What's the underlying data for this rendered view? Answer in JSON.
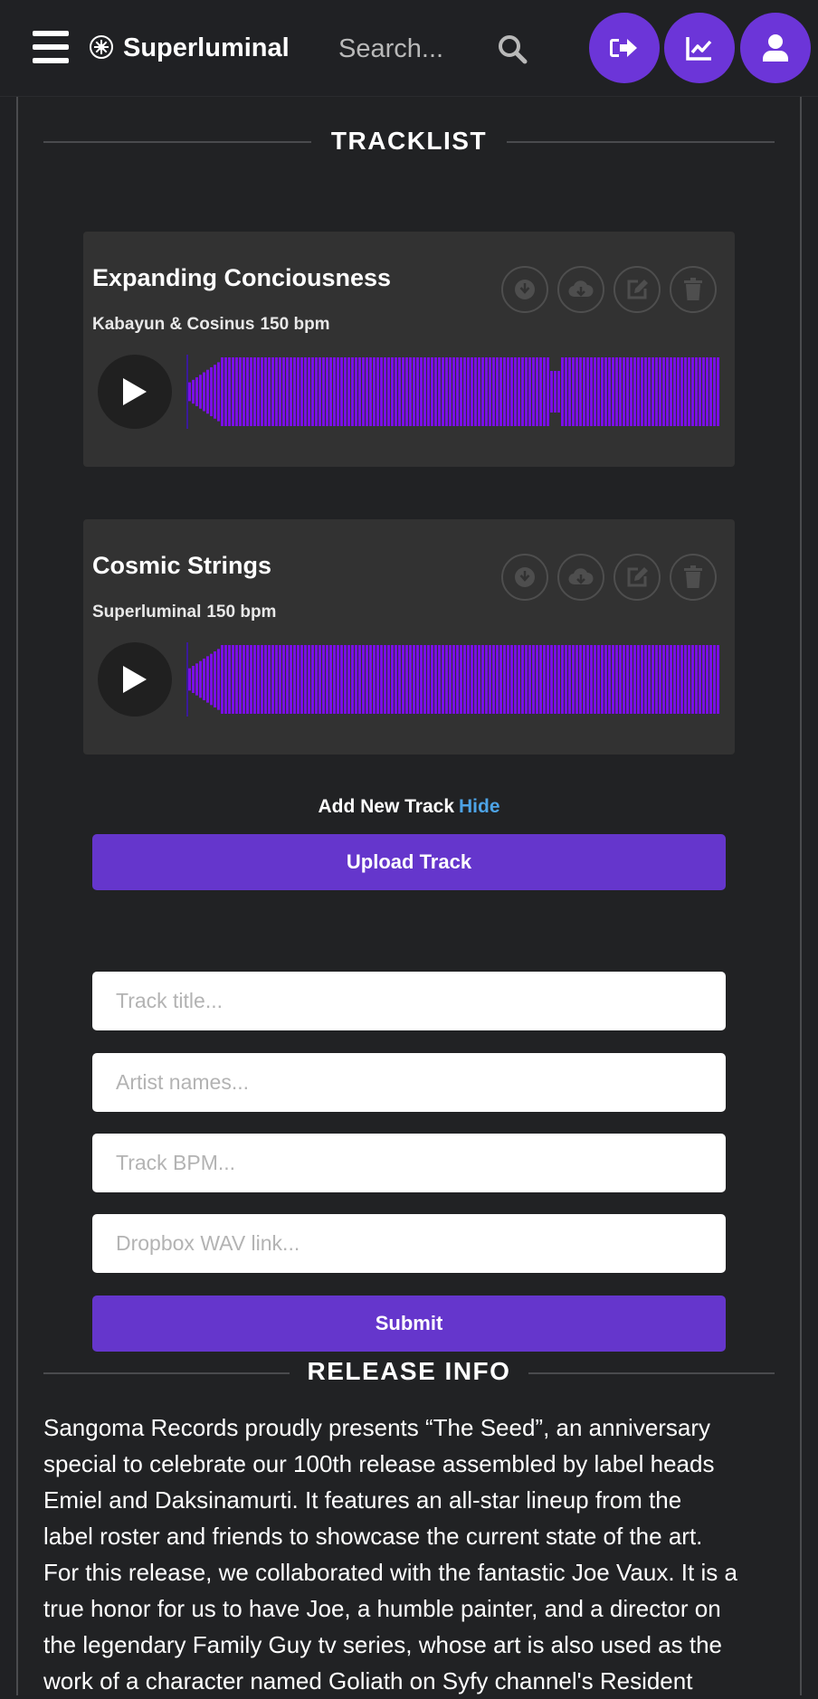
{
  "header": {
    "brand": "Superluminal",
    "search_placeholder": "Search..."
  },
  "tracklist": {
    "heading": "TRACKLIST",
    "tracks": [
      {
        "title": "Expanding Conciousness",
        "artist": "Kabayun & Cosinus",
        "bpm": "150 bpm"
      },
      {
        "title": "Cosmic Strings",
        "artist": "Superluminal",
        "bpm": "150 bpm"
      }
    ]
  },
  "add_track": {
    "label": "Add New Track",
    "hide_link": "Hide",
    "upload_button": "Upload Track",
    "fields": {
      "title_placeholder": "Track title...",
      "artist_placeholder": "Artist names...",
      "bpm_placeholder": "Track BPM...",
      "link_placeholder": "Dropbox WAV link..."
    },
    "submit_button": "Submit"
  },
  "release_info": {
    "heading": "RELEASE INFO",
    "lines": [
      "Sangoma Records proudly presents “The Seed”, an anniversary",
      "special to celebrate our 100th release assembled by label heads",
      "Emiel and Daksinamurti. It features an all-star lineup from the",
      "label roster and friends to showcase the current state of the art.",
      "For this release, we collaborated with the fantastic Joe Vaux. It is a",
      "true honor for us to have Joe, a humble painter, and a director on",
      "the legendary Family Guy tv series, whose art is also used as the",
      "work of a character named Goliath on Syfy channel's Resident"
    ]
  },
  "colors": {
    "accent": "#6c35d8",
    "waveform": "#7a0fe6",
    "link": "#4da3e6",
    "background": "#202124",
    "card": "#323232"
  },
  "icons": [
    "hamburger-icon",
    "logo-icon",
    "search-icon",
    "sign-out-icon",
    "chart-icon",
    "user-icon",
    "download-icon",
    "cloud-download-icon",
    "edit-icon",
    "trash-icon",
    "play-icon"
  ]
}
